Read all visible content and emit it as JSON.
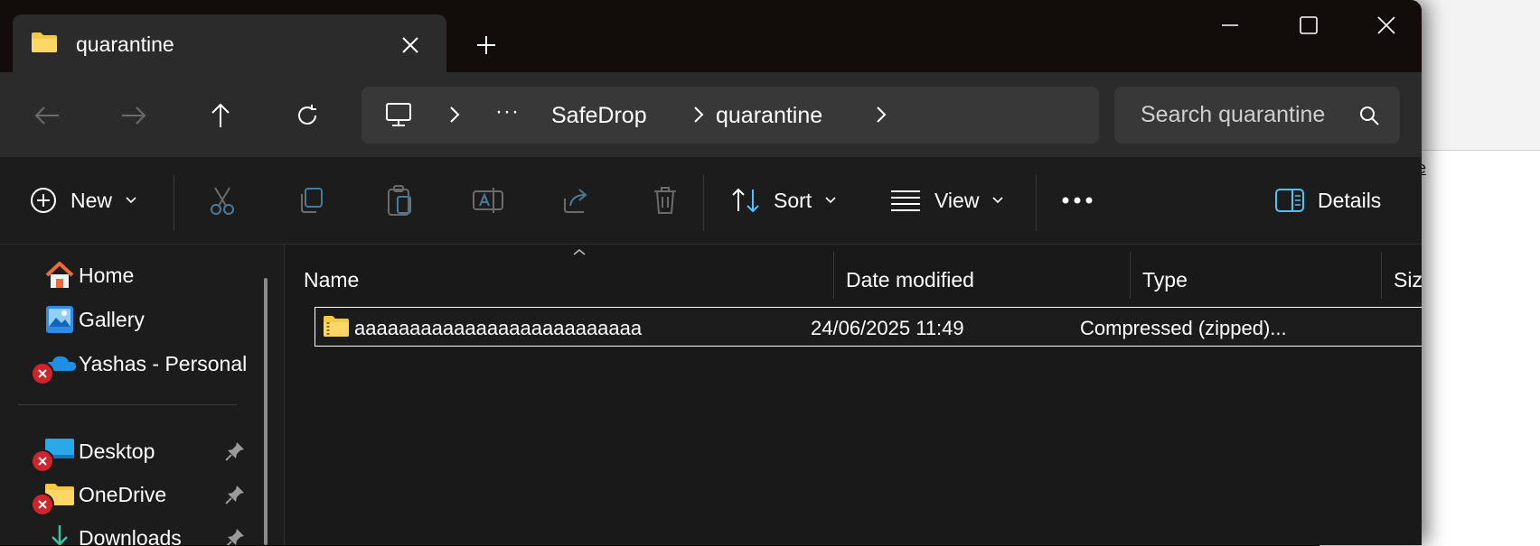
{
  "window": {
    "tab_title": "quarantine"
  },
  "nav": {
    "breadcrumb": [
      "SafeDrop",
      "quarantine"
    ],
    "overflow": "···",
    "search_placeholder": "Search quarantine"
  },
  "commands": {
    "new_label": "New",
    "sort_label": "Sort",
    "view_label": "View",
    "details_label": "Details"
  },
  "sidebar": {
    "items": [
      {
        "label": "Home"
      },
      {
        "label": "Gallery"
      },
      {
        "label": "Yashas - Personal"
      },
      {
        "label": "Desktop"
      },
      {
        "label": "OneDrive"
      },
      {
        "label": "Downloads"
      }
    ]
  },
  "columns": [
    "Name",
    "Date modified",
    "Type",
    "Size"
  ],
  "files": [
    {
      "name": "aaaaaaaaaaaaaaaaaaaaaaaaaa",
      "date_modified": "24/06/2025 11:49",
      "type": "Compressed (zipped)..."
    }
  ],
  "backdrop": {
    "fragment_text": "e"
  },
  "colors": {
    "accent": "#4cc2ff",
    "folder_yellow": "#f8c843",
    "error_red": "#d1232a"
  }
}
